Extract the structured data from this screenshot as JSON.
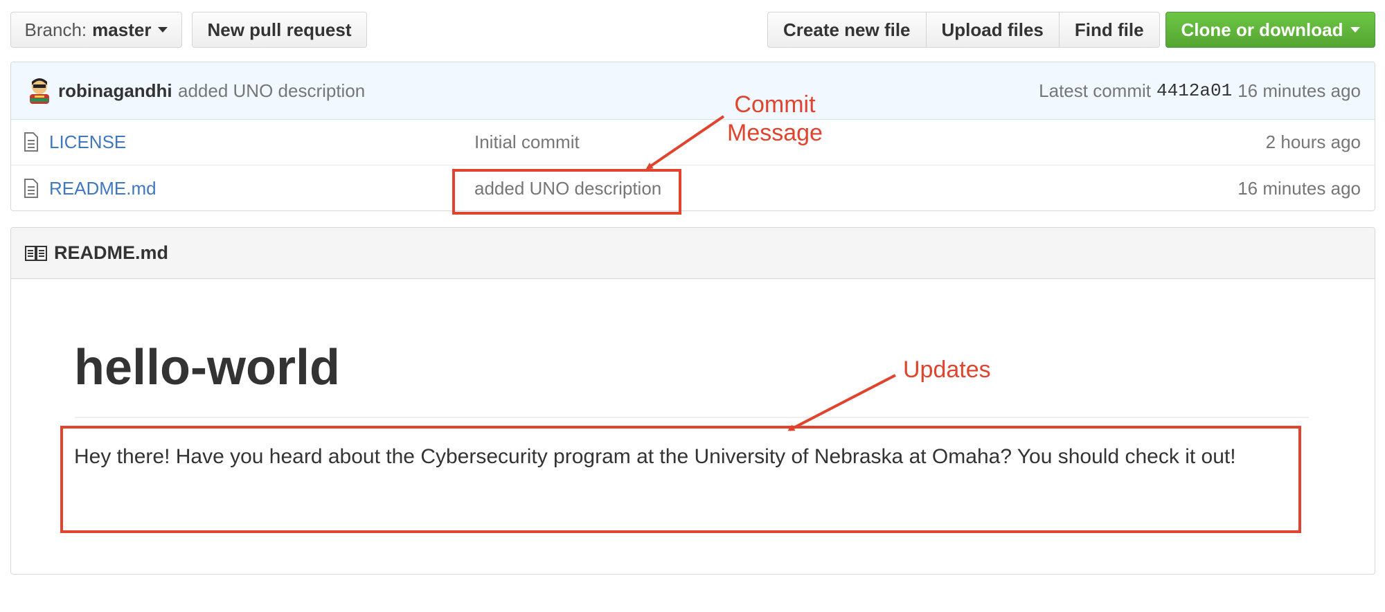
{
  "toolbar": {
    "branch_label": "Branch:",
    "branch_value": "master",
    "new_pr": "New pull request",
    "create_file": "Create new file",
    "upload_files": "Upload files",
    "find_file": "Find file",
    "clone": "Clone or download"
  },
  "commit": {
    "author": "robinagandhi",
    "message": "added UNO description",
    "latest_label": "Latest commit",
    "sha": "4412a01",
    "age": "16 minutes ago"
  },
  "files": [
    {
      "name": "LICENSE",
      "message": "Initial commit",
      "age": "2 hours ago"
    },
    {
      "name": "README.md",
      "message": "added UNO description",
      "age": "16 minutes ago"
    }
  ],
  "readme": {
    "filename": "README.md",
    "heading": "hello-world",
    "body": "Hey there! Have you heard about the Cybersecurity program at the University of Nebraska at Omaha? You should check it out!"
  },
  "annotations": {
    "commit_line1": "Commit",
    "commit_line2": "Message",
    "updates": "Updates",
    "color": "#e0442e"
  },
  "colors": {
    "link": "#4078c0",
    "clone_button": "#6cc644",
    "commit_bar": "#f1f8ff"
  }
}
